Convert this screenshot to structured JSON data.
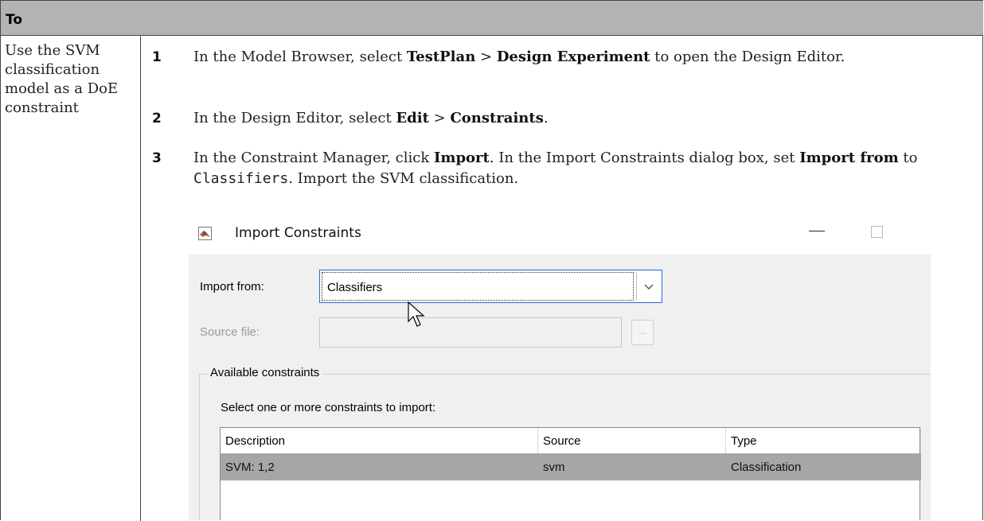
{
  "table": {
    "header": "To",
    "task": "Use the SVM classification model as a DoE constraint",
    "steps": [
      {
        "num": "1",
        "parts": [
          "In the Model Browser, select ",
          "TestPlan",
          " > ",
          "Design Experiment",
          " to open the Design Editor."
        ]
      },
      {
        "num": "2",
        "parts": [
          "In the Design Editor, select ",
          "Edit",
          " > ",
          "Constraints",
          "."
        ]
      },
      {
        "num": "3",
        "parts": [
          "In the Constraint Manager, click ",
          "Import",
          ". In the Import Constraints dialog box, set ",
          "Import from",
          " to ",
          "Classifiers",
          ". Import the SVM classification."
        ]
      }
    ]
  },
  "dialog": {
    "title": "Import Constraints",
    "import_from_label": "Import from:",
    "import_from_value": "Classifiers",
    "source_file_label": "Source file:",
    "browse_label": "...",
    "group_label": "Available constraints",
    "instruction": "Select one or more constraints to import:",
    "columns": [
      "Description",
      "Source",
      "Type"
    ],
    "rows": [
      {
        "description": "SVM: 1,2",
        "source": "svm",
        "type": "Classification"
      }
    ],
    "icons": [
      "matlab-logo-icon",
      "minimize-icon",
      "maximize-icon",
      "chevron-down-icon",
      "mouse-cursor-icon"
    ]
  },
  "colors": {
    "header_bg": "#b3b3b3",
    "selected_row": "#a6a6a6",
    "dialog_bg": "#f0f0f0"
  }
}
